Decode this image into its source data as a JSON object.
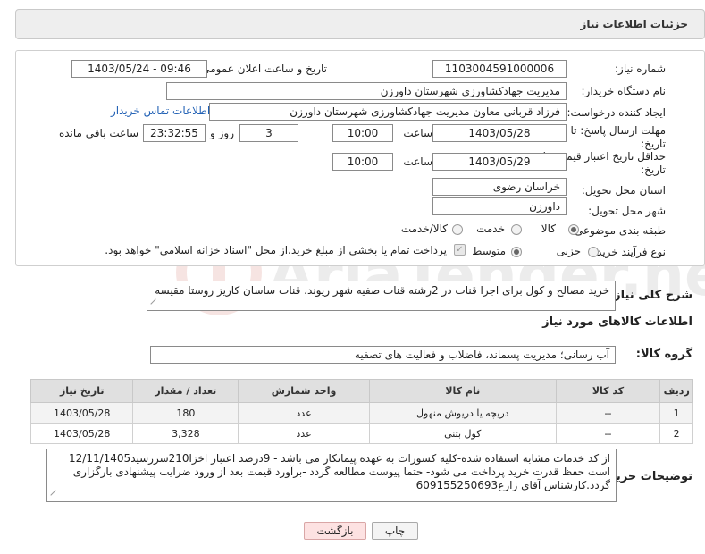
{
  "header": {
    "title": "جزئیات اطلاعات نیاز"
  },
  "form": {
    "need_number": {
      "label": "شماره نیاز:",
      "value": "1103004591000006"
    },
    "announce_date": {
      "label": "تاریخ و ساعت اعلان عمومی:",
      "value": "1403/05/24 - 09:46"
    },
    "buyer_org": {
      "label": "نام دستگاه خریدار:",
      "value": "مدیریت جهادکشاورزی شهرستان داورزن"
    },
    "requester": {
      "label": "ایجاد کننده درخواست:",
      "value": "فرزاد قربانی معاون مدیریت جهادکشاورزی شهرستان داورزن",
      "contact_link": "اطلاعات تماس خریدار"
    },
    "reply_deadline": {
      "label_line1": "مهلت ارسال پاسخ: تا",
      "label_line2": "تاریخ:",
      "date": "1403/05/28",
      "time_label": "ساعت",
      "time": "10:00",
      "days": "3",
      "days_label": "روز و",
      "remaining": "23:32:55",
      "remaining_label": "ساعت باقی مانده"
    },
    "price_validity": {
      "label_line1": "حداقل تاریخ اعتبار قیمت: تا",
      "label_line2": "تاریخ:",
      "date": "1403/05/29",
      "time_label": "ساعت",
      "time": "10:00"
    },
    "province": {
      "label": "استان محل تحویل:",
      "value": "خراسان رضوی"
    },
    "city": {
      "label": "شهر محل تحویل:",
      "value": "داورزن"
    },
    "category": {
      "label": "طبقه بندی موضوعی:",
      "options": [
        "کالا",
        "خدمت",
        "کالا/خدمت"
      ],
      "selected": "کالا"
    },
    "purchase_type": {
      "label": "نوع فرآیند خرید :",
      "options": [
        "جزیی",
        "متوسط"
      ],
      "selected": "متوسط",
      "payment_note": "پرداخت تمام یا بخشی از مبلغ خرید،از محل \"اسناد خزانه اسلامی\" خواهد بود."
    }
  },
  "description": {
    "label": "شرح کلی نیاز:",
    "value": "خرید مصالح و کول برای اجرا قنات در 2رشته قنات صفیه شهر ریوند، قنات ساسان کاریز روستا مقیسه"
  },
  "goods_section": {
    "title": "اطلاعات کالاهای مورد نیاز",
    "group_label": "گروه کالا:",
    "group_value": "آب رسانی؛ مدیریت پسماند، فاضلاب و فعالیت های تصفیه"
  },
  "table": {
    "headers": [
      "ردیف",
      "کد کالا",
      "نام کالا",
      "واحد شمارش",
      "تعداد / مقدار",
      "تاریخ نیاز"
    ],
    "rows": [
      [
        "1",
        "--",
        "دریچه یا دریوش منهول",
        "عدد",
        "180",
        "1403/05/28"
      ],
      [
        "2",
        "--",
        "کول بتنی",
        "عدد",
        "3,328",
        "1403/05/28"
      ]
    ]
  },
  "buyer_notes": {
    "label": "توضیحات خریدار:",
    "value": "از کد خدمات مشابه استفاده شده-کلیه کسورات به عهده پیمانکار می باشد - 9درصد اعتبار اخزا210سررسید12/11/1405 است حفظ قدرت خرید پرداخت می شود- حتما پیوست مطالعه گردد -برآورد قیمت بعد از ورود ضرایب پیشنهادی بارگزاری گردد.کارشناس  آقای زارع09155250693‏6"
  },
  "buttons": {
    "print": "چاپ",
    "back": "بازگشت"
  },
  "colors": {
    "link": "#1f5fb4",
    "header_bg": "#eeeeee",
    "back_button": "#fde2e2"
  }
}
